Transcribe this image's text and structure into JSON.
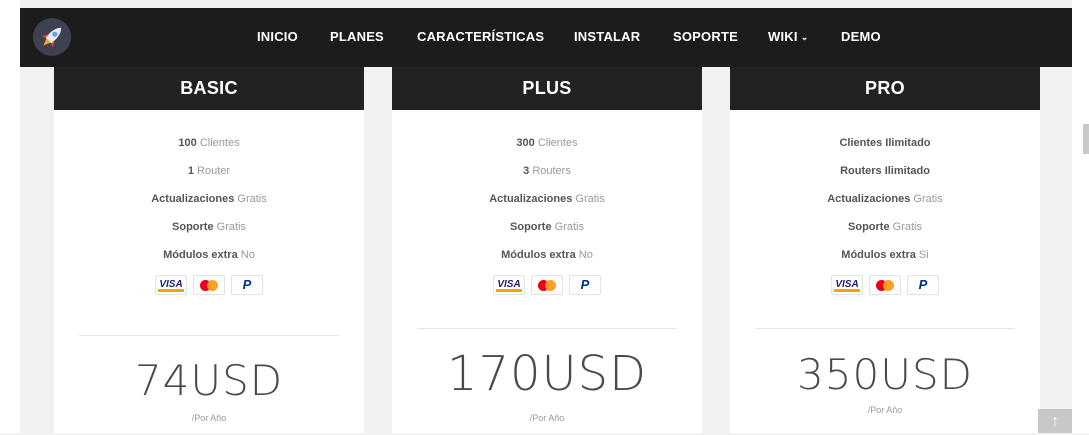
{
  "nav": {
    "items": [
      "INICIO",
      "PLANES",
      "CARACTERÍSTICAS",
      "INSTALAR",
      "SOPORTE",
      "WIKI",
      "DEMO"
    ],
    "wiki_dropdown": true
  },
  "plans": [
    {
      "name": "BASIC",
      "features": [
        {
          "strong": "100",
          "text": " Clientes"
        },
        {
          "strong": "1",
          "text": " Router"
        },
        {
          "strong": "Actualizaciones",
          "text": " Gratis"
        },
        {
          "strong": "Soporte",
          "text": " Gratis"
        },
        {
          "strong": "Módulos extra",
          "text": " No"
        }
      ],
      "price": "74USD",
      "period": "/Por Año"
    },
    {
      "name": "PLUS",
      "features": [
        {
          "strong": "300",
          "text": " Clientes"
        },
        {
          "strong": "3",
          "text": " Routers"
        },
        {
          "strong": "Actualizaciones",
          "text": " Gratis"
        },
        {
          "strong": "Soporte",
          "text": " Gratis"
        },
        {
          "strong": "Módulos extra",
          "text": " No"
        }
      ],
      "price": "170USD",
      "period": "/Por Año"
    },
    {
      "name": "PRO",
      "features": [
        {
          "strong": "Clientes Ilimitado",
          "text": ""
        },
        {
          "strong": "Routers Ilimitado",
          "text": ""
        },
        {
          "strong": "Actualizaciones",
          "text": " Gratis"
        },
        {
          "strong": "Soporte",
          "text": " Gratis"
        },
        {
          "strong": "Módulos extra",
          "text": " Si"
        }
      ],
      "price": "350USD",
      "period": "/Por Año"
    }
  ],
  "payment_methods": {
    "visa_label": "VISA",
    "icons": [
      "visa-icon",
      "mastercard-icon",
      "paypal-icon"
    ]
  },
  "colors": {
    "navbar": "#1c1c1c",
    "plan_header": "#222222",
    "background": "#f2f2f2"
  },
  "back_to_top_icon": "arrow-up-icon"
}
